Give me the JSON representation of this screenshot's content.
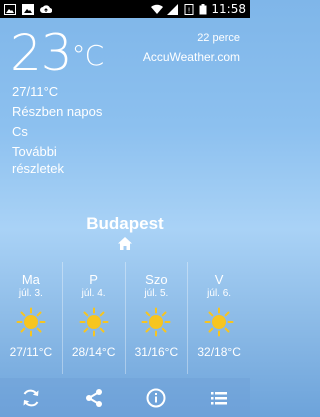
{
  "status_bar": {
    "time": "11:58"
  },
  "weather": {
    "current_temp": "23",
    "unit": "°C",
    "updated": "22 perce",
    "provider": "AccuWeather.com",
    "hi_lo": "27/11°C",
    "condition": "Részben napos",
    "day_abbr": "Cs",
    "more_link": "További részletek",
    "city": "Budapest"
  },
  "forecast": [
    {
      "day": "Ma",
      "date": "júl. 3.",
      "temp": "27/11°C",
      "icon": "sun-icon"
    },
    {
      "day": "P",
      "date": "júl. 4.",
      "temp": "28/14°C",
      "icon": "sun-icon"
    },
    {
      "day": "Szo",
      "date": "júl. 5.",
      "temp": "31/16°C",
      "icon": "sun-icon"
    },
    {
      "day": "V",
      "date": "júl. 6.",
      "temp": "32/18°C",
      "icon": "sun-icon"
    }
  ],
  "toolbar": [
    "refresh-icon",
    "share-icon",
    "info-icon",
    "list-icon"
  ],
  "colors": {
    "sun": "#f7c520",
    "status_bar": "#000000"
  }
}
